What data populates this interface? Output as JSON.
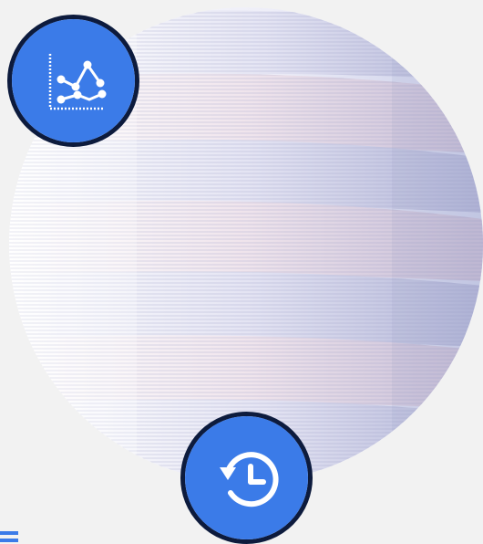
{
  "illustration": {
    "photo_subject": "paper-stack",
    "badges": [
      {
        "icon": "line-chart-icon"
      },
      {
        "icon": "history-icon"
      }
    ]
  },
  "colors": {
    "background": "#f2f2f2",
    "badge_fill": "#3b7be8",
    "badge_border": "#0d1b3d",
    "icon_stroke": "#ffffff",
    "corner_mark": "#3b7be8"
  }
}
